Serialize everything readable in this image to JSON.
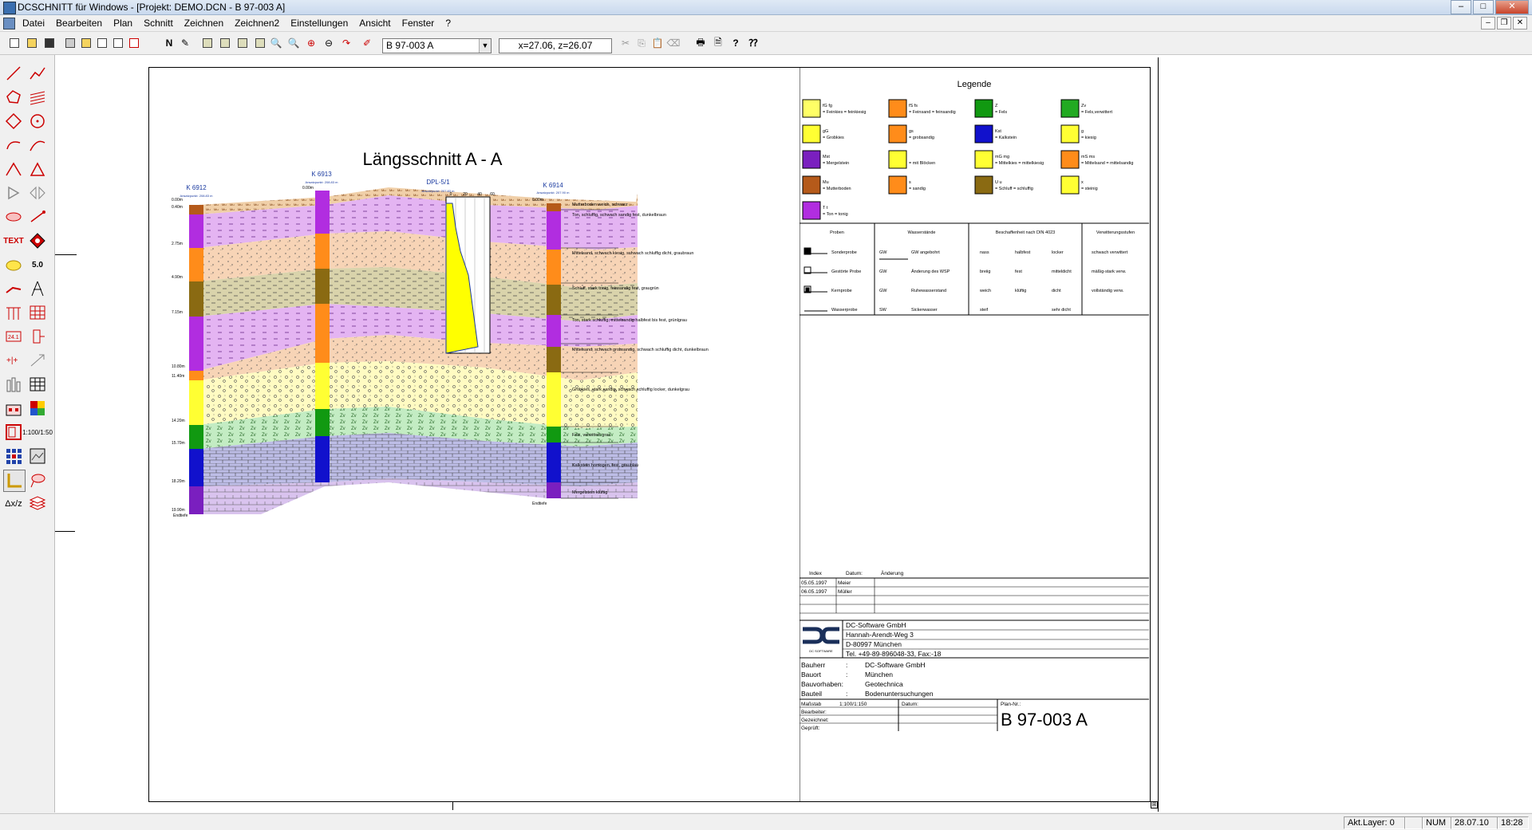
{
  "window": {
    "title": "DCSCHNITT für Windows - [Projekt: DEMO.DCN - B 97-003 A]"
  },
  "menu": [
    "Datei",
    "Bearbeiten",
    "Plan",
    "Schnitt",
    "Zeichnen",
    "Zeichnen2",
    "Einstellungen",
    "Ansicht",
    "Fenster",
    "?"
  ],
  "toolbar": {
    "plan_selector": "B 97-003 A",
    "coordinates": "x=27.06, z=26.07"
  },
  "lefttools": {
    "text_tool": "TEXT",
    "value_tool": "5.0",
    "scale_tool": "1:100/1:50",
    "label_tool": "Δx/z"
  },
  "drawing": {
    "title": "Längsschnitt A - A",
    "boreholes": [
      {
        "name": "K 6912",
        "anchor": "Ansatzpunkt: 208.83 m"
      },
      {
        "name": "K 6913",
        "anchor": "Ansatzpunkt: 208.83 m"
      },
      {
        "name": "DPL-5/1",
        "anchor": "Ansatzpunkt: 207.83 m"
      },
      {
        "name": "K 6914",
        "anchor": "Ansatzpunkt: 207.90 m"
      }
    ],
    "depths": [
      "0.00m",
      "0.40m",
      "2.75m",
      "4.90m",
      "7.15m",
      "10.80m",
      "11.40m",
      "14.20m",
      "15.70m",
      "18.20m",
      "19.90m"
    ],
    "top_depth_label": "0.00m",
    "end_label": "Endtiefe",
    "penetration_scale": [
      "0",
      "20",
      "40",
      "60"
    ],
    "descriptions": [
      "Mutterboden weich, schwarz",
      "Ton, schluffig, schwach sandig fest, dunkelbraun",
      "Mittelsand, schwach kiesig, schwach schluffig dicht, graubraun",
      "Schluff, stark tonig, feinsandig fest, graugrün",
      "Ton, stark schluffig, mittelsandig halbfest bis fest, grünlgrau",
      "Mittelsand, schwach grobsandig, schwach schluffig dicht, dunkelbraun",
      "Grobkies, stark sandig, schwach schluffig locker, dunkelgrau",
      "Fels, verwittert grau",
      "Kalkstein homogen, fest, graublau",
      "Mergelstein klüftig"
    ]
  },
  "legend": {
    "title": "Legende",
    "items": [
      {
        "code": "fG fg",
        "text": "= Feinkies = feinkiesig",
        "color": "#ffff66"
      },
      {
        "code": "fS fs",
        "text": "= Feinsand = feinsandig",
        "color": "#ff8c1a"
      },
      {
        "code": "Z",
        "text": "= Fels",
        "color": "#119911"
      },
      {
        "code": "Zv",
        "text": "= Fels,verwittert",
        "color": "#22aa22"
      },
      {
        "code": "gG",
        "text": "= Grobkies",
        "color": "#ffff33"
      },
      {
        "code": "gs",
        "text": "= grobsandig",
        "color": "#ff8c1a"
      },
      {
        "code": "Kst",
        "text": "= Kalkstein",
        "color": "#1111cc"
      },
      {
        "code": "g",
        "text": "= kiesig",
        "color": "#ffff33"
      },
      {
        "code": "Mst",
        "text": "= Mergelstein",
        "color": "#7a1fbf"
      },
      {
        "code": "",
        "text": "= mit Blöcken",
        "color": "#ffff33"
      },
      {
        "code": "mG mg",
        "text": "= Mittelkies = mittelkiesig",
        "color": "#ffff33"
      },
      {
        "code": "mS ms",
        "text": "= Mittelsand = mittelsandig",
        "color": "#ff8c1a"
      },
      {
        "code": "Mu",
        "text": "= Mutterboden",
        "color": "#b55a1a"
      },
      {
        "code": "s",
        "text": "= sandig",
        "color": "#ff8c1a"
      },
      {
        "code": "U u",
        "text": "= Schluff = schluffig",
        "color": "#8a6a12"
      },
      {
        "code": "x",
        "text": "= steinig",
        "color": "#ffff33"
      },
      {
        "code": "T t",
        "text": "= Ton = tonig",
        "color": "#b12de0"
      }
    ],
    "columns": [
      "Proben",
      "Wasserstände",
      "Beschaffenheit nach DIN 4023",
      "Verwitterungsstufen"
    ],
    "proben": [
      "Sonderprobe",
      "Gestörte Probe",
      "Kernprobe",
      "Wasserprobe"
    ],
    "wasser": [
      "GW angebohrt",
      "Änderung des WSP",
      "Ruhewasserstand",
      "Sickerwasser"
    ],
    "wasser_codes": [
      "GW",
      "GW",
      "GW",
      "SW"
    ],
    "beschaffenheit": [
      "nass",
      "halbfest",
      "locker",
      "breiig",
      "fest",
      "mitteldicht",
      "weich",
      "klüftig",
      "dicht",
      "steif",
      "sehr dicht"
    ],
    "verwitterung": [
      "schwach verwittert",
      "mäßig-stark verw.",
      "vollständig verw."
    ]
  },
  "revisions": {
    "headers": [
      "Index",
      "Datum:",
      "Änderung"
    ],
    "rows": [
      {
        "date": "05.05.1997",
        "name": "Meier"
      },
      {
        "date": "06.05.1997",
        "name": "Müller"
      }
    ]
  },
  "company": {
    "logo_text": "DC SOFTWARE",
    "lines": [
      "DC-Software GmbH",
      "Hannah-Arendt-Weg 3",
      "D-80997 München",
      "Tel. +49-89-896048-33, Fax:-18"
    ]
  },
  "project": [
    {
      "label": "Bauherr",
      "value": "DC-Software GmbH"
    },
    {
      "label": "Bauort",
      "value": "München"
    },
    {
      "label": "Bauvorhaben:",
      "value": "Geotechnica"
    },
    {
      "label": "Bauteil",
      "value": "Bodenuntersuchungen"
    }
  ],
  "titleblock": {
    "massstab_label": "Maßstab",
    "massstab_value": "1:100/1:150",
    "datum_label": "Datum:",
    "plan_label": "Plan-Nr.:",
    "bearbeiter": "Bearbeiter:",
    "gezeichnet": "Gezeichnet:",
    "geprueft": "Geprüft:",
    "plan_number": "B 97-003 A"
  },
  "status": {
    "layer": "Akt.Layer: 0",
    "num": "NUM",
    "date": "28.07.10",
    "time": "18:28"
  }
}
